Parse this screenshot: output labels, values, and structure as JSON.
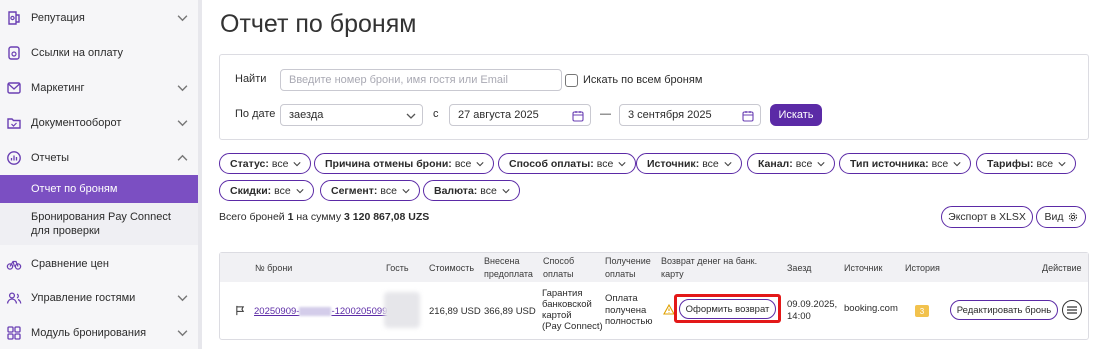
{
  "sidebar": {
    "items": [
      {
        "label": "Репутация",
        "icon": "reputation-icon",
        "chevron": "chevron-down-icon"
      },
      {
        "label": "Ссылки на оплату",
        "icon": "payment-link-icon"
      },
      {
        "label": "Маркетинг",
        "icon": "mail-icon",
        "chevron": "chevron-down-icon"
      },
      {
        "label": "Документооборот",
        "icon": "documents-icon",
        "chevron": "chevron-down-icon"
      },
      {
        "label": "Отчеты",
        "icon": "reports-icon",
        "chevron": "chevron-up-icon"
      },
      {
        "label": "Сравнение цен",
        "icon": "bicycle-icon"
      },
      {
        "label": "Управление гостями",
        "icon": "guests-icon",
        "chevron": "chevron-down-icon"
      },
      {
        "label": "Модуль бронирования",
        "icon": "grid-icon",
        "chevron": "chevron-down-icon"
      }
    ],
    "subitems": [
      {
        "label": "Отчет по броням",
        "active": true
      },
      {
        "label_line1": "Бронирования Pay Connect",
        "label_line2": "для проверки"
      }
    ]
  },
  "page": {
    "title": "Отчет по броням"
  },
  "filters": {
    "find_label": "Найти",
    "search_placeholder": "Введите номер брони, имя гостя или Email",
    "search_all_label": "Искать по всем броням",
    "date_label": "По дате",
    "date_type": "заезда",
    "from_label": "с",
    "date_from": "27 августа 2025",
    "dash": "—",
    "date_to": "3 сентября 2025",
    "search_button": "Искать"
  },
  "chips": [
    {
      "key": "Статус:",
      "value": "все"
    },
    {
      "key": "Причина отмены брони:",
      "value": "все"
    },
    {
      "key": "Способ оплаты:",
      "value": "все"
    },
    {
      "key": "Источник:",
      "value": "все"
    },
    {
      "key": "Канал:",
      "value": "все"
    },
    {
      "key": "Тип источника:",
      "value": "все"
    },
    {
      "key": "Тарифы:",
      "value": "все"
    },
    {
      "key": "Скидки:",
      "value": "все"
    },
    {
      "key": "Сегмент:",
      "value": "все"
    },
    {
      "key": "Валюта:",
      "value": "все"
    }
  ],
  "summary": {
    "prefix": "Всего броней",
    "count": "1",
    "middle": "на сумму",
    "amount": "3 120 867,08 UZS"
  },
  "actions": {
    "export": "Экспорт в XLSX",
    "view": "Вид"
  },
  "table": {
    "headers": {
      "number": "№ брони",
      "guest": "Гость",
      "cost": "Стоимость",
      "prepaid_1": "Внесена",
      "prepaid_2": "предоплата",
      "method_1": "Способ",
      "method_2": "оплаты",
      "receipt_1": "Получение",
      "receipt_2": "оплаты",
      "refund_1": "Возврат денег на банк.",
      "refund_2": "карту",
      "checkin": "Заезд",
      "source": "Источник",
      "history": "История",
      "action": "Действие"
    },
    "row": {
      "number_a": "20250909-",
      "number_b": "-1200205099",
      "cost": "216,89 USD",
      "prepaid": "366,89 USD",
      "method_lines": [
        "Гарантия",
        "банковской",
        "картой",
        "(Pay Connect)"
      ],
      "receipt_lines": [
        "Оплата",
        "получена",
        "полностью"
      ],
      "refund_button": "Оформить возврат",
      "checkin_date": "09.09.2025,",
      "checkin_time": "14:00",
      "source": "booking.com",
      "history": "3",
      "edit_button": "Редактировать бронь"
    }
  },
  "colors": {
    "accent": "#5b2aa6",
    "active_nav": "#7b4fc2",
    "highlight": "#e31818",
    "warning": "#f2c24d"
  }
}
